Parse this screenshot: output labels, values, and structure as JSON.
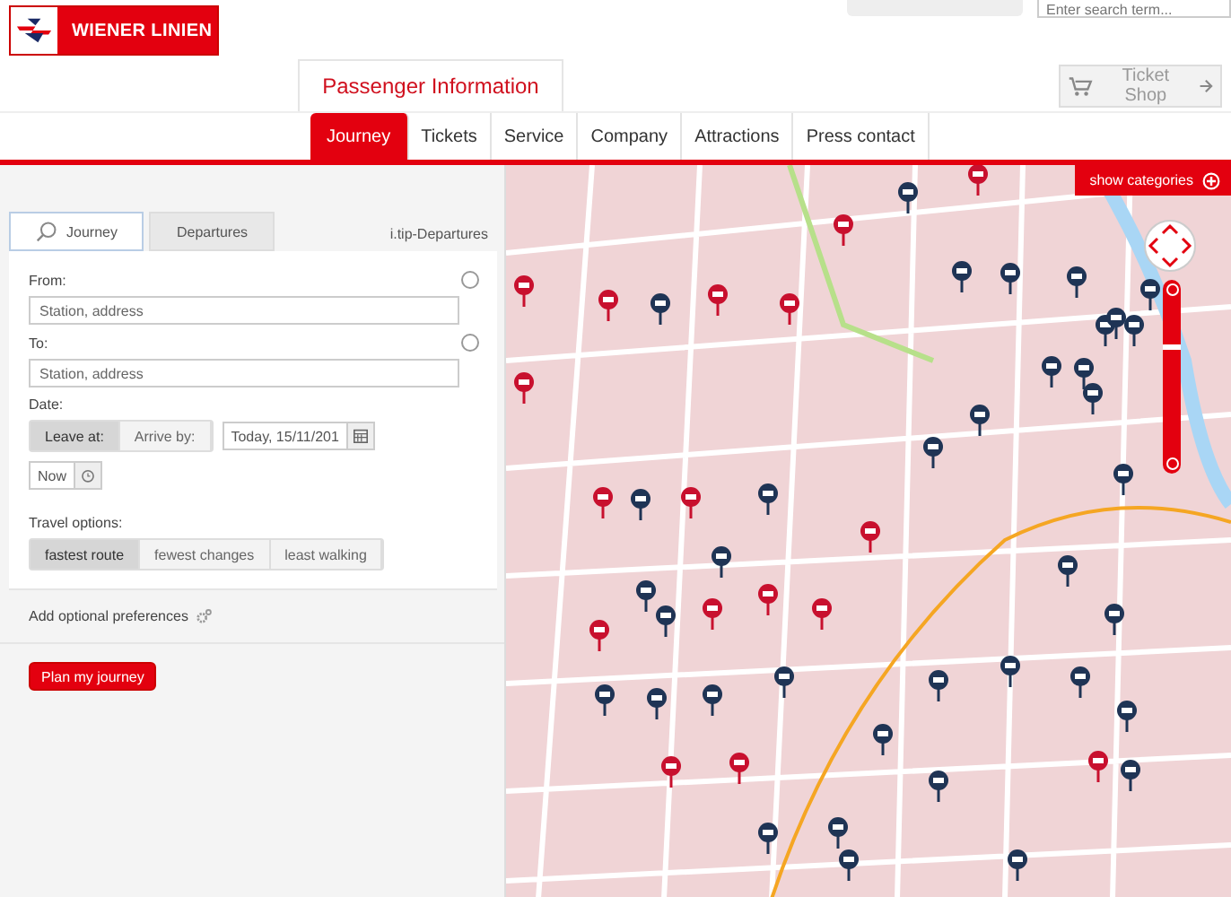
{
  "header": {
    "logo_text": "WIENER LINIEN",
    "search": {
      "placeholder": "Enter search term..."
    },
    "section_tab": "Passenger Information",
    "ticket_shop": "Ticket Shop"
  },
  "nav": [
    {
      "label": "Journey",
      "selected": true
    },
    {
      "label": "Tickets",
      "selected": false
    },
    {
      "label": "Service",
      "selected": false
    },
    {
      "label": "Company",
      "selected": false
    },
    {
      "label": "Attractions",
      "selected": false
    },
    {
      "label": "Press contact",
      "selected": false
    }
  ],
  "planner": {
    "tabs": [
      {
        "label": "Journey",
        "selected": true
      },
      {
        "label": "Departures",
        "selected": false
      }
    ],
    "tip_link": "i.tip-Departures",
    "from": {
      "label": "From:",
      "placeholder": "Station, address"
    },
    "to": {
      "label": "To:",
      "placeholder": "Station, address"
    },
    "date_label": "Date:",
    "time_mode": [
      {
        "label": "Leave at:",
        "selected": true
      },
      {
        "label": "Arrive by:",
        "selected": false
      }
    ],
    "date_value": "Today, 15/11/201",
    "time_value": "Now",
    "options_label": "Travel options:",
    "options": [
      {
        "label": "fastest route",
        "selected": true
      },
      {
        "label": "fewest changes",
        "selected": false
      },
      {
        "label": "least walking",
        "selected": false
      }
    ],
    "preferences": "Add optional preferences",
    "submit": "Plan my journey"
  },
  "map": {
    "show_categories": "show categories",
    "zoom": {
      "level": 0.67
    }
  }
}
